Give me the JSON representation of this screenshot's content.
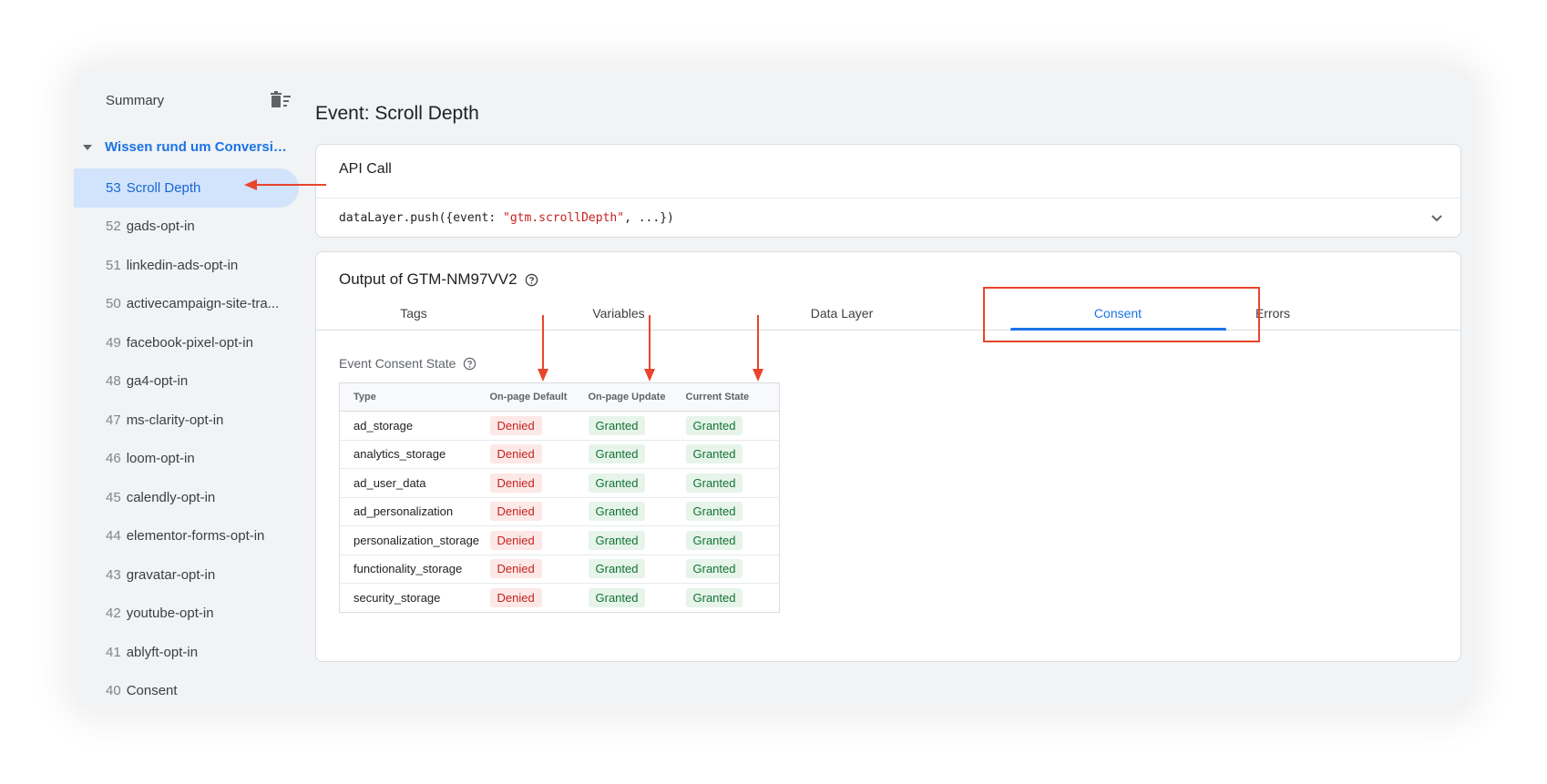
{
  "sidebar": {
    "summary_label": "Summary",
    "group_label": "Wissen rund um Conversio...",
    "items": [
      {
        "num": "53",
        "label": "Scroll Depth",
        "active": true
      },
      {
        "num": "52",
        "label": "gads-opt-in"
      },
      {
        "num": "51",
        "label": "linkedin-ads-opt-in"
      },
      {
        "num": "50",
        "label": "activecampaign-site-tra..."
      },
      {
        "num": "49",
        "label": "facebook-pixel-opt-in"
      },
      {
        "num": "48",
        "label": "ga4-opt-in"
      },
      {
        "num": "47",
        "label": "ms-clarity-opt-in"
      },
      {
        "num": "46",
        "label": "loom-opt-in"
      },
      {
        "num": "45",
        "label": "calendly-opt-in"
      },
      {
        "num": "44",
        "label": "elementor-forms-opt-in"
      },
      {
        "num": "43",
        "label": "gravatar-opt-in"
      },
      {
        "num": "42",
        "label": "youtube-opt-in"
      },
      {
        "num": "41",
        "label": "ablyft-opt-in"
      },
      {
        "num": "40",
        "label": "Consent"
      }
    ]
  },
  "main": {
    "title": "Event: Scroll Depth",
    "api_call": {
      "title": "API Call",
      "code_prefix": "dataLayer.push({event: ",
      "code_string": "\"gtm.scrollDepth\"",
      "code_suffix": ", ...})"
    },
    "output": {
      "title": "Output of GTM-NM97VV2",
      "tabs": [
        "Tags",
        "Variables",
        "Data Layer",
        "Consent",
        "Errors"
      ],
      "active_tab": "Consent",
      "consent_state_label": "Event Consent State",
      "table": {
        "headers": [
          "Type",
          "On-page Default",
          "On-page Update",
          "Current State"
        ],
        "rows": [
          [
            "ad_storage",
            "Denied",
            "Granted",
            "Granted"
          ],
          [
            "analytics_storage",
            "Denied",
            "Granted",
            "Granted"
          ],
          [
            "ad_user_data",
            "Denied",
            "Granted",
            "Granted"
          ],
          [
            "ad_personalization",
            "Denied",
            "Granted",
            "Granted"
          ],
          [
            "personalization_storage",
            "Denied",
            "Granted",
            "Granted"
          ],
          [
            "functionality_storage",
            "Denied",
            "Granted",
            "Granted"
          ],
          [
            "security_storage",
            "Denied",
            "Granted",
            "Granted"
          ]
        ]
      }
    }
  },
  "colors": {
    "accent": "#1a73e8",
    "annotation": "#e8452c",
    "denied_text": "#c5221f",
    "granted_text": "#137333"
  }
}
